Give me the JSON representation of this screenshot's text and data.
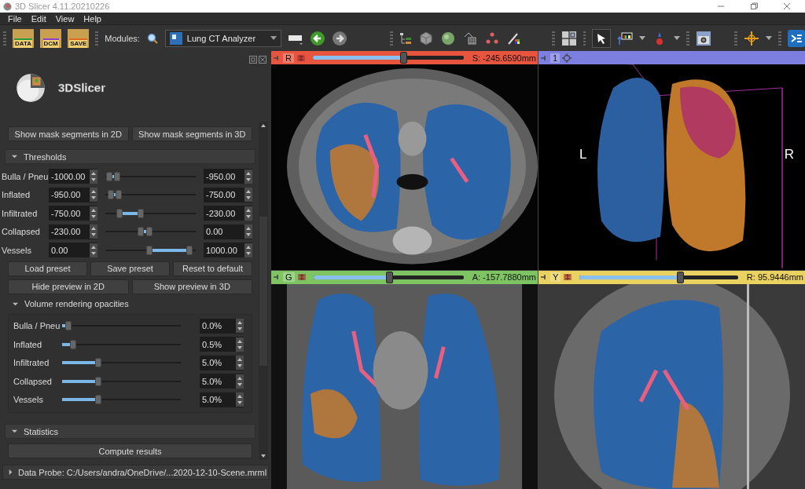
{
  "window": {
    "title": "3D Slicer 4.11.20210226"
  },
  "menu": [
    "File",
    "Edit",
    "View",
    "Help"
  ],
  "toolbar": {
    "file_buttons": [
      "DATA",
      "DCM",
      "SAVE"
    ],
    "modules_label": "Modules:",
    "module": "Lung CT Analyzer",
    "mouse_modes": [
      {
        "selected": true
      }
    ]
  },
  "panel": {
    "logo": "3DSlicer",
    "mask_buttons": [
      "Show mask segments in 2D",
      "Show mask segments in 3D"
    ],
    "thresholds": {
      "title": "Thresholds",
      "expanded": true,
      "rows": [
        {
          "label": "Bulla / Pneu",
          "min": "-1000.00",
          "max": "-950.00",
          "handles": [
            {
              "level": 0.01
            },
            {
              "level": 0.1
            }
          ]
        },
        {
          "label": "Inflated",
          "min": "-950.00",
          "max": "-750.00",
          "handles": [
            {
              "level": 0.03
            },
            {
              "level": 0.12
            }
          ]
        },
        {
          "label": "Infiltrated",
          "min": "-750.00",
          "max": "-230.00",
          "handles": [
            {
              "level": 0.13
            },
            {
              "level": 0.38
            }
          ]
        },
        {
          "label": "Collapsed",
          "min": "-230.00",
          "max": "0.00",
          "handles": [
            {
              "level": 0.38
            },
            {
              "level": 0.49
            }
          ]
        },
        {
          "label": "Vessels",
          "min": "0.00",
          "max": "1000.00",
          "handles": [
            {
              "level": 0.49
            },
            {
              "level": 0.96
            }
          ]
        }
      ]
    },
    "preset_buttons": [
      "Load preset",
      "Save preset",
      "Reset to default"
    ],
    "preview_buttons": [
      "Hide preview in 2D",
      "Show preview in 3D"
    ],
    "opacities": {
      "title": "Volume rendering opacities",
      "expanded": true,
      "rows": [
        {
          "label": "Bulla / Pneu",
          "level": 0.0,
          "value": "0.0%"
        },
        {
          "label": "Inflated",
          "level": 0.04,
          "value": "0.5%"
        },
        {
          "label": "Infiltrated",
          "level": 0.27,
          "value": "5.0%"
        },
        {
          "label": "Collapsed",
          "level": 0.27,
          "value": "5.0%"
        },
        {
          "label": "Vessels",
          "level": 0.27,
          "value": "5.0%"
        }
      ]
    },
    "statistics": {
      "title": "Statistics",
      "expanded": true,
      "buttons": [
        "Compute results"
      ]
    }
  },
  "data_probe": {
    "label": "Data Probe: C:/Users/andra/OneDrive/...2020-12-10-Scene.mrml",
    "expanded": false
  },
  "views": [
    {
      "kind": "axial",
      "label": "R",
      "color": "#e8553e",
      "level": 0.61,
      "reading": "S: -245.6590mm"
    },
    {
      "kind": "volume",
      "label": "1",
      "color": "#7d7fe0",
      "orientation_labels": [
        "L",
        "R"
      ]
    },
    {
      "kind": "coronal",
      "label": "G",
      "color": "#7ec463",
      "level": 0.51,
      "reading": "A: -157.7880mm"
    },
    {
      "kind": "sagittal",
      "label": "Y",
      "color": "#e9d25f",
      "level": 0.64,
      "reading": "R: 95.9446mm"
    }
  ]
}
